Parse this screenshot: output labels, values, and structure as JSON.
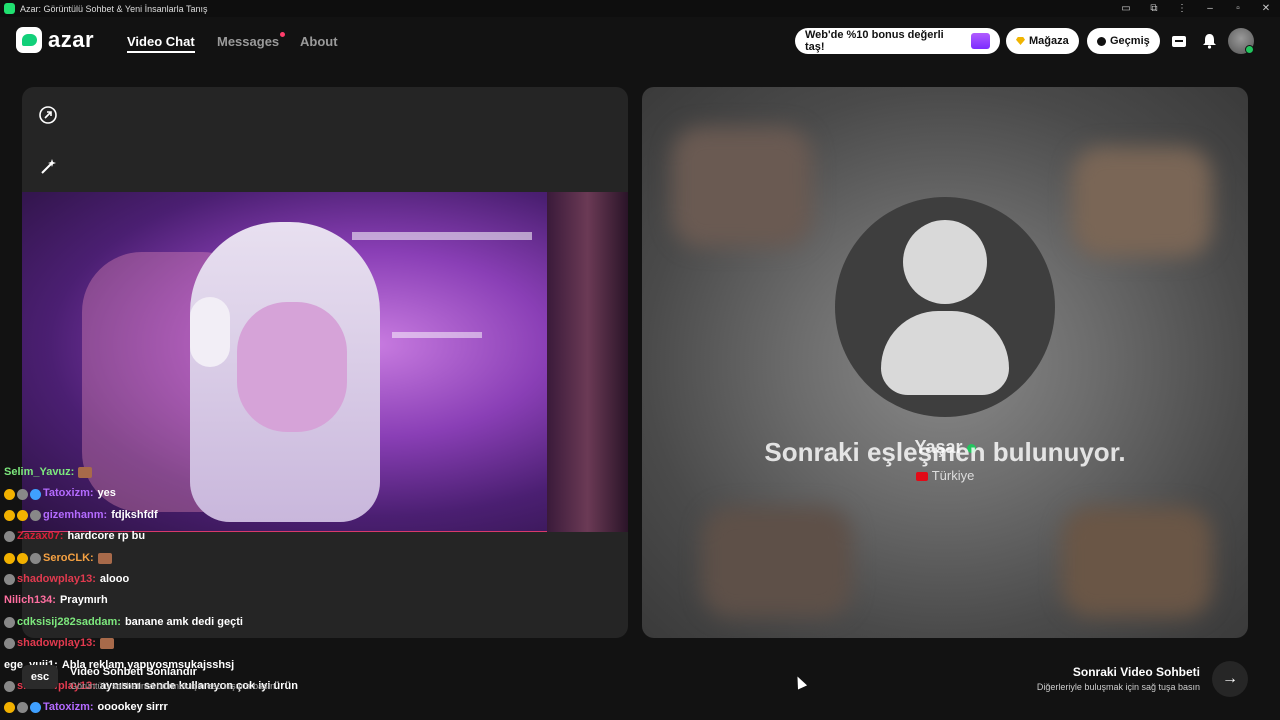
{
  "window": {
    "title": "Azar: Görüntülü Sohbet & Yeni İnsanlarla Tanış"
  },
  "nav": {
    "logo_text": "azar",
    "links": [
      {
        "label": "Video Chat",
        "active": true
      },
      {
        "label": "Messages",
        "has_dot": true
      },
      {
        "label": "About"
      }
    ],
    "promo": "Web'de %10 bonus değerli taş!",
    "shop": "Mağaza",
    "history": "Geçmiş"
  },
  "peer": {
    "name": "Yaşar",
    "country": "Türkiye",
    "status": "Sonraki eşleşmen bulunuyor."
  },
  "chat": [
    {
      "user": "Selim_Yavuz:",
      "message": "",
      "color": "#7de87d",
      "emote": true
    },
    {
      "user": "Tatoxizm:",
      "message": "yes",
      "color": "#b46bff",
      "badges": [
        "#f2b100",
        "#888",
        "#3fa0ff"
      ]
    },
    {
      "user": "gizemhanm:",
      "message": "fdjkshfdf",
      "color": "#b46bff",
      "badges": [
        "#f2b100",
        "#f2b100",
        "#888"
      ]
    },
    {
      "user": "Zazax07:",
      "message": "hardcore rp bu",
      "color": "#d8203a",
      "badges": [
        "#888"
      ]
    },
    {
      "user": "SeroCLK:",
      "message": "",
      "color": "#f5a142",
      "badges": [
        "#f2b100",
        "#f2b100",
        "#888"
      ],
      "emote": true
    },
    {
      "user": "shadowplay13:",
      "message": "alooo",
      "color": "#e23a4f",
      "badges": [
        "#888"
      ]
    },
    {
      "user": "Nilich134:",
      "message": "Praymırh",
      "color": "#ff6fa0"
    },
    {
      "user": "cdksisij282saddam:",
      "message": "banane amk dedi geçti",
      "color": "#7de87d",
      "badges": [
        "#888"
      ]
    },
    {
      "user": "shadowplay13:",
      "message": "",
      "color": "#e23a4f",
      "badges": [
        "#888"
      ],
      "emote": true
    },
    {
      "user": "ege_yuji1:",
      "message": "Abla reklam yapıyosmsukajsshsj",
      "color": "#ffffff"
    },
    {
      "user": "shadowplay13:",
      "message": "aynısını sende kullanıyon çok iyi ürün",
      "color": "#e23a4f",
      "badges": [
        "#888"
      ]
    },
    {
      "user": "Tatoxizm:",
      "message": "ooookey sirrr",
      "color": "#b46bff",
      "badges": [
        "#f2b100",
        "#888",
        "#3fa0ff"
      ]
    }
  ],
  "footer": {
    "esc_key": "esc",
    "esc_title": "Video Sohbeti Sonlandır",
    "esc_sub": "Görüntülü sohbetinizi bitirmek için esc tuşuna basın",
    "next_title": "Sonraki Video Sohbeti",
    "next_sub": "Diğerleriyle buluşmak için sağ tuşa basın",
    "next_arrow": "→"
  }
}
